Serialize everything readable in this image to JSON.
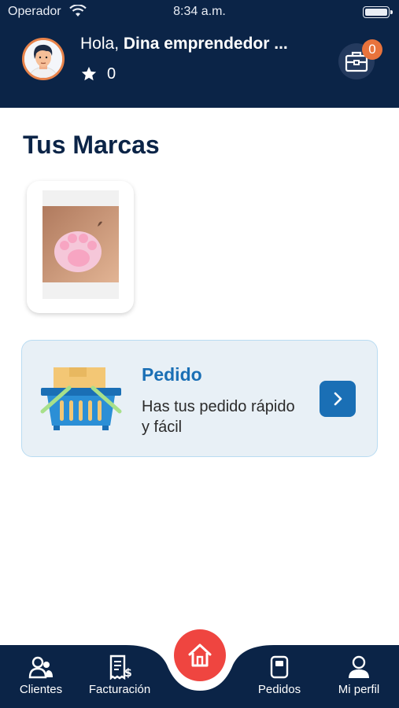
{
  "status_bar": {
    "carrier": "Operador",
    "time": "8:34 a.m."
  },
  "header": {
    "greeting_prefix": "Hola,",
    "user_name": "Dina  emprendedor ...",
    "points": "0",
    "cart_badge": "0"
  },
  "main": {
    "section_title": "Tus Marcas",
    "order_card": {
      "title": "Pedido",
      "description": "Has tus pedido rápido y fácil"
    }
  },
  "bottom_nav": {
    "items": [
      {
        "label": "Clientes",
        "icon": "clients-icon"
      },
      {
        "label": "Facturación",
        "icon": "invoice-icon"
      },
      {
        "label": "Pedidos",
        "icon": "orders-icon"
      },
      {
        "label": "Mi perfil",
        "icon": "profile-icon"
      }
    ],
    "center_icon": "home-icon"
  },
  "colors": {
    "header_bg": "#0b2447",
    "accent_blue": "#1a6fb5",
    "badge_orange": "#e8733c",
    "home_red": "#ef4540"
  }
}
